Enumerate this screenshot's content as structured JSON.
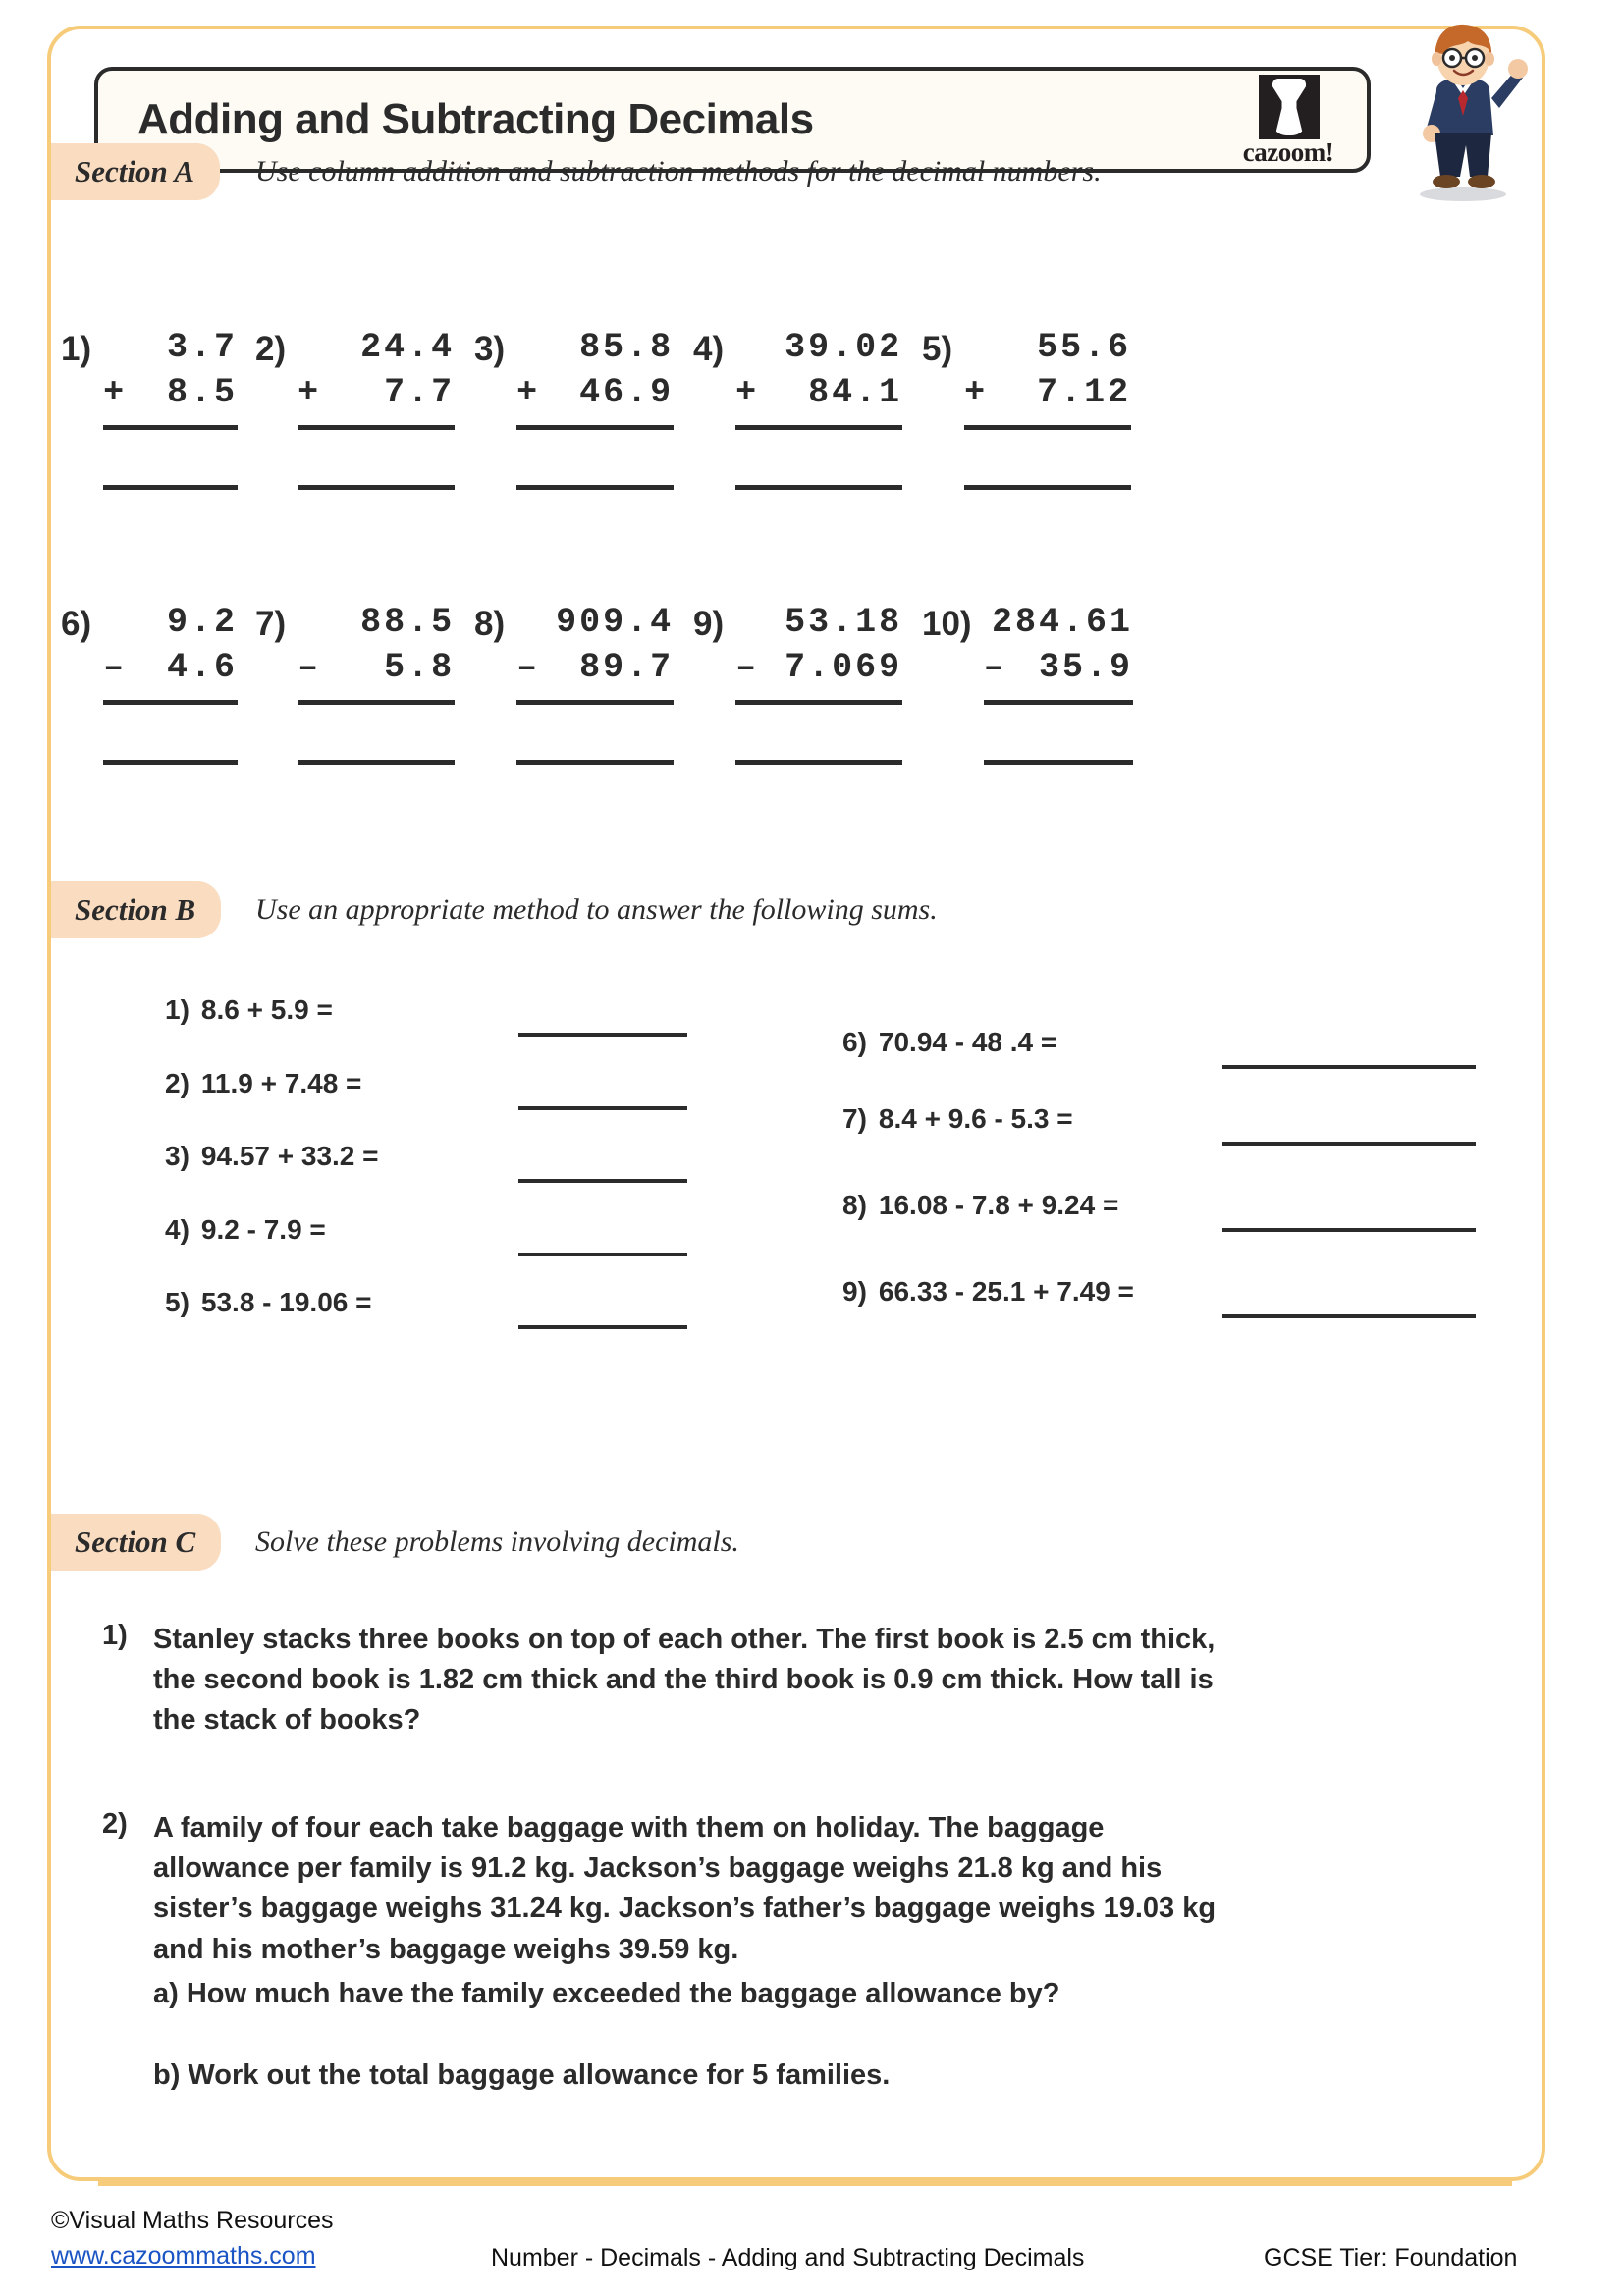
{
  "header": {
    "title": "Adding and Subtracting Decimals",
    "logo_wordmark": "cazoom!"
  },
  "sections": {
    "a": {
      "label": "Section A",
      "instruction": "Use column addition and subtraction methods for the decimal numbers."
    },
    "b": {
      "label": "Section B",
      "instruction": "Use an appropriate method to answer the following sums."
    },
    "c": {
      "label": "Section C",
      "instruction": "Solve these problems involving decimals."
    }
  },
  "section_a_problems": [
    {
      "num": "1)",
      "top": "3.7",
      "op": "+",
      "bottom": "8.5"
    },
    {
      "num": "2)",
      "top": "24.4",
      "op": "+",
      "bottom": "7.7"
    },
    {
      "num": "3)",
      "top": "85.8",
      "op": "+",
      "bottom": "46.9"
    },
    {
      "num": "4)",
      "top": "39.02",
      "op": "+",
      "bottom": "84.1"
    },
    {
      "num": "5)",
      "top": "55.6",
      "op": "+",
      "bottom": "7.12"
    },
    {
      "num": "6)",
      "top": "9.2",
      "op": "–",
      "bottom": "4.6"
    },
    {
      "num": "7)",
      "top": "88.5",
      "op": "–",
      "bottom": "5.8"
    },
    {
      "num": "8)",
      "top": "909.4",
      "op": "–",
      "bottom": "89.7"
    },
    {
      "num": "9)",
      "top": "53.18",
      "op": "–",
      "bottom": "7.069"
    },
    {
      "num": "10)",
      "top": "284.61",
      "op": "–",
      "bottom": "35.9"
    }
  ],
  "section_b_problems": [
    {
      "num": "1)",
      "text": "8.6 + 5.9 ="
    },
    {
      "num": "2)",
      "text": "11.9 + 7.48 ="
    },
    {
      "num": "3)",
      "text": "94.57 + 33.2 ="
    },
    {
      "num": "4)",
      "text": "9.2 - 7.9 ="
    },
    {
      "num": "5)",
      "text": "53.8 - 19.06 ="
    },
    {
      "num": "6)",
      "text": "70.94 - 48 .4 ="
    },
    {
      "num": "7)",
      "text": "8.4 + 9.6 - 5.3 ="
    },
    {
      "num": "8)",
      "text": "16.08 - 7.8 + 9.24 ="
    },
    {
      "num": "9)",
      "text": "66.33 - 25.1 + 7.49 ="
    }
  ],
  "section_c_problems": [
    {
      "num": "1)",
      "lines": [
        "Stanley stacks three books on top of each other. The first book is 2.5 cm thick,",
        "the second book is 1.82 cm thick and the third book is 0.9 cm thick. How tall is",
        "the stack of books?"
      ],
      "parts": []
    },
    {
      "num": "2)",
      "lines": [
        "A family of four each take baggage with them on holiday. The baggage",
        "allowance per family is 91.2 kg. Jackson’s baggage weighs 21.8 kg and his",
        "sister’s baggage weighs 31.24 kg. Jackson’s father’s baggage weighs 19.03 kg",
        "and his mother’s baggage weighs 39.59 kg."
      ],
      "parts": [
        "a) How much have the family exceeded the baggage allowance by?",
        "b) Work out the total baggage allowance for 5 families."
      ]
    }
  ],
  "footer": {
    "copyright": "©Visual Maths Resources",
    "url": "www.cazoommaths.com",
    "topic": "Number - Decimals - Adding and Subtracting Decimals",
    "tier": "GCSE Tier: Foundation"
  }
}
